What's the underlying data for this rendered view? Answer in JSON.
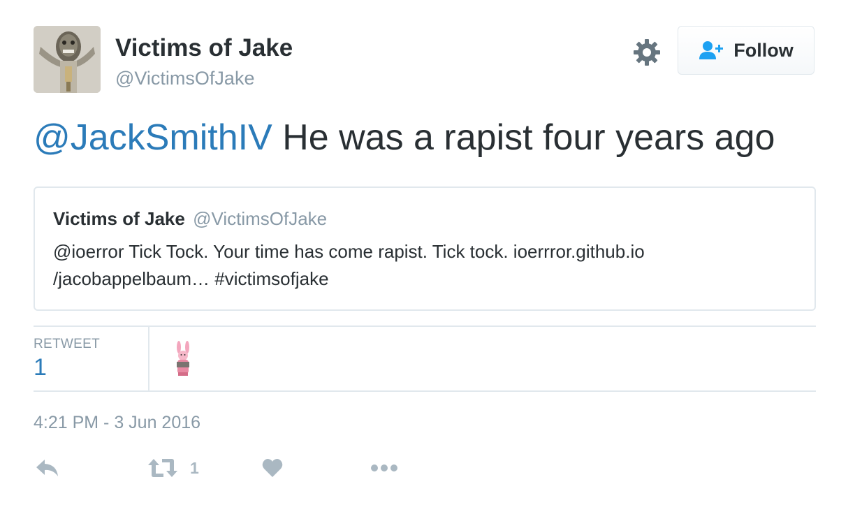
{
  "author": {
    "display_name": "Victims of Jake",
    "screen_name": "@VictimsOfJake"
  },
  "header": {
    "settings_icon": "gear-icon",
    "follow_label": "Follow",
    "follow_icon": "follow-user-icon"
  },
  "tweet": {
    "mention": "@JackSmithIV",
    "text": " He was a rapist four years ago"
  },
  "quoted_tweet": {
    "display_name": "Victims of Jake",
    "screen_name": "@VictimsOfJake",
    "line1": "@ioerror Tick Tock. Your time has come rapist. Tick tock. ioerrror.github.io",
    "line2": "/jacobappelbaum… #victimsofjake"
  },
  "stats": {
    "retweet_label": "RETWEET",
    "retweet_count": "1"
  },
  "timestamp": "4:21 PM - 3 Jun 2016",
  "actions": {
    "reply_icon": "reply-icon",
    "retweet_icon": "retweet-icon",
    "retweet_count": "1",
    "like_icon": "heart-icon",
    "more_icon": "more-dots-icon"
  },
  "colors": {
    "link": "#2b7bb9",
    "muted": "#8899a6",
    "action_icon": "#aab8c2",
    "border": "#e1e8ed",
    "text": "#292f33"
  }
}
